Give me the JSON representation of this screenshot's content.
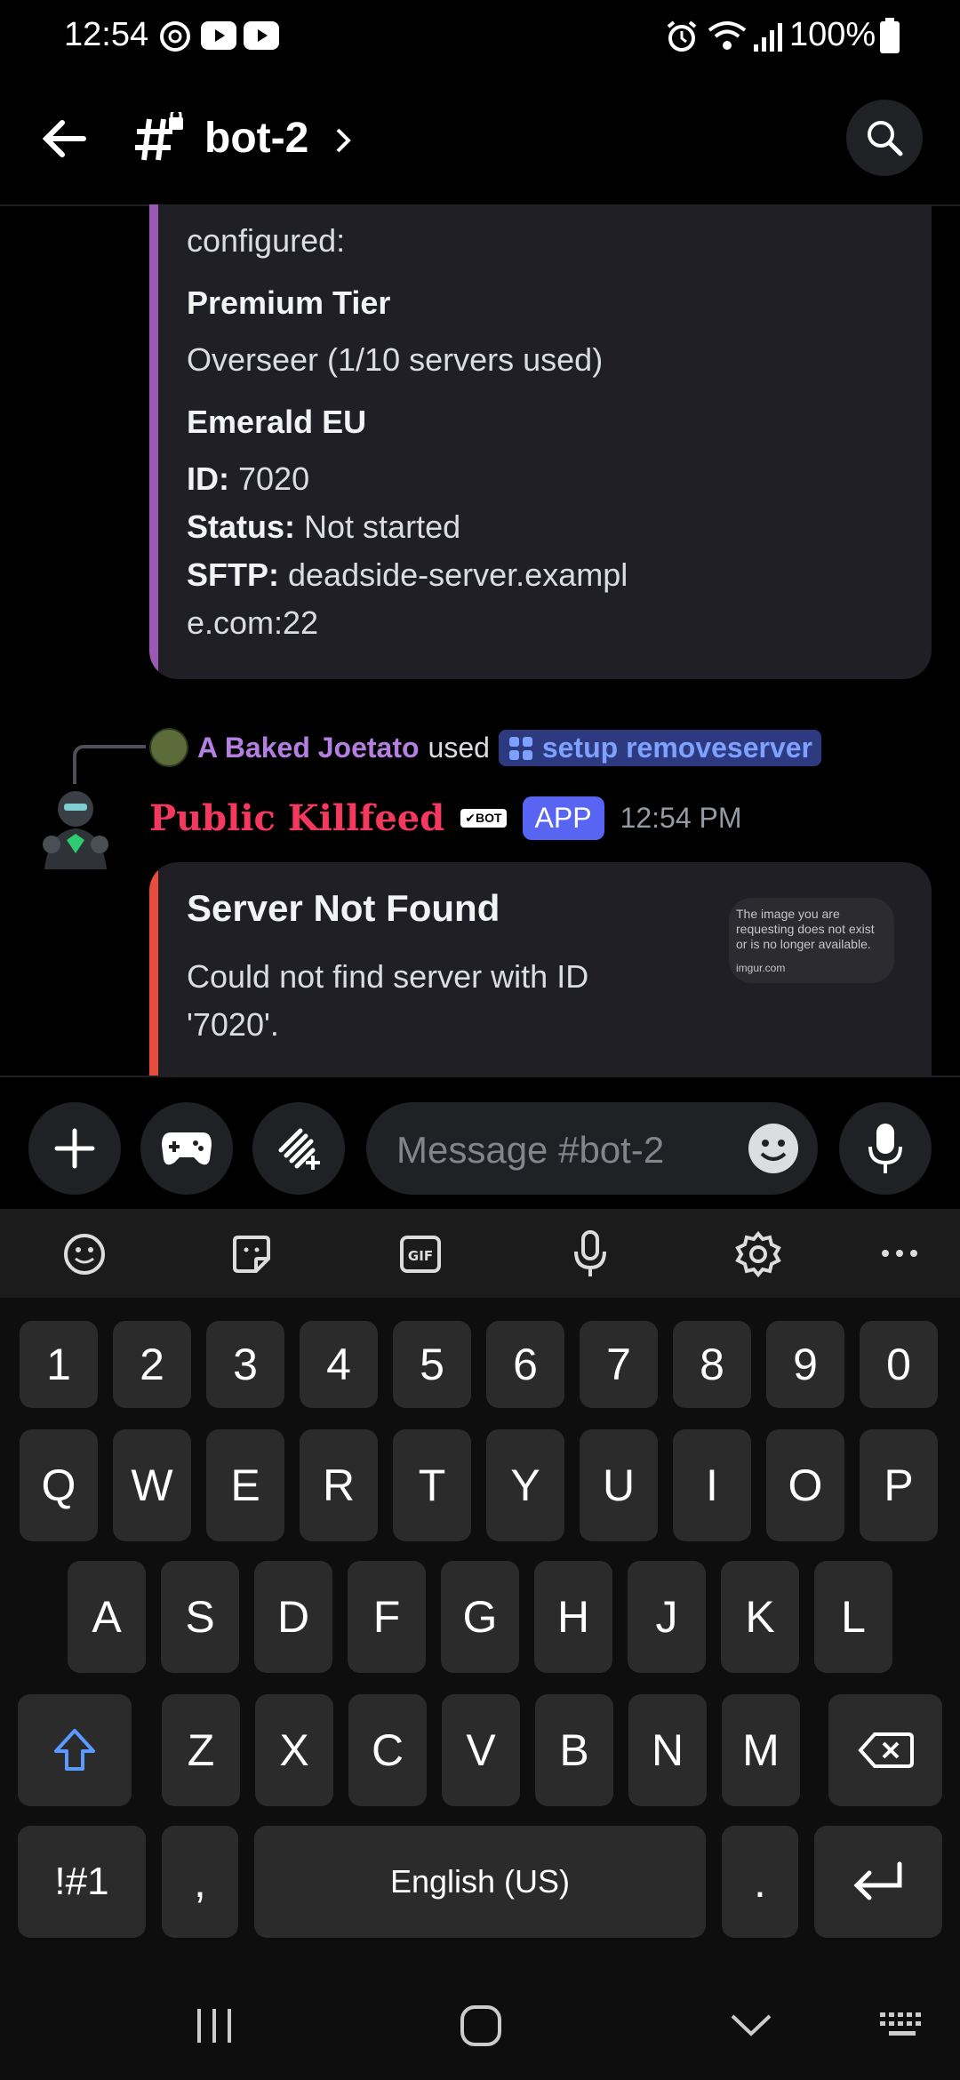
{
  "status_bar": {
    "time": "12:54",
    "battery": "100%"
  },
  "header": {
    "channel": "bot-2"
  },
  "messages": {
    "first_embed": {
      "configured_text": "configured:",
      "tier_title": "Premium Tier",
      "tier_value": "Overseer (1/10 servers used)",
      "server_name": "Emerald EU",
      "id_label": "ID:",
      "id_value": "7020",
      "status_label": "Status:",
      "status_value": "Not started",
      "sftp_label": "SFTP:",
      "sftp_value_1": "deadside-server.exampl",
      "sftp_value_2": "e.com:22"
    },
    "reply": {
      "user": "A Baked Joetato",
      "used_word": "used",
      "command": "setup removeserver"
    },
    "bot": {
      "name": "Public Killfeed",
      "bot_tag": "BOT",
      "app_badge": "APP",
      "timestamp": "12:54 PM"
    },
    "second_embed": {
      "title": "Server Not Found",
      "desc_1": "Could not find server with ID",
      "desc_2": "'7020'.",
      "thumb_line_1": "The image you are",
      "thumb_line_2": "requesting does not exist",
      "thumb_line_3": "or is no longer available.",
      "thumb_line_4": "imgur.com"
    }
  },
  "composer": {
    "placeholder": "Message #bot-2"
  },
  "keyboard": {
    "row_numbers": [
      "1",
      "2",
      "3",
      "4",
      "5",
      "6",
      "7",
      "8",
      "9",
      "0"
    ],
    "row_q": [
      "Q",
      "W",
      "E",
      "R",
      "T",
      "Y",
      "U",
      "I",
      "O",
      "P"
    ],
    "row_a": [
      "A",
      "S",
      "D",
      "F",
      "G",
      "H",
      "J",
      "K",
      "L"
    ],
    "row_z": [
      "Z",
      "X",
      "C",
      "V",
      "B",
      "N",
      "M"
    ],
    "symbols_key": "!#1",
    "comma_key": ",",
    "space_label": "English (US)",
    "period_key": "."
  },
  "colors": {
    "accent_purple": "#9b59b6",
    "accent_red": "#e74c3c",
    "username_purple": "#b47fe0",
    "bot_name_red": "#f5385e",
    "link_blue": "#5b9bff",
    "blurple": "#5865f2"
  }
}
